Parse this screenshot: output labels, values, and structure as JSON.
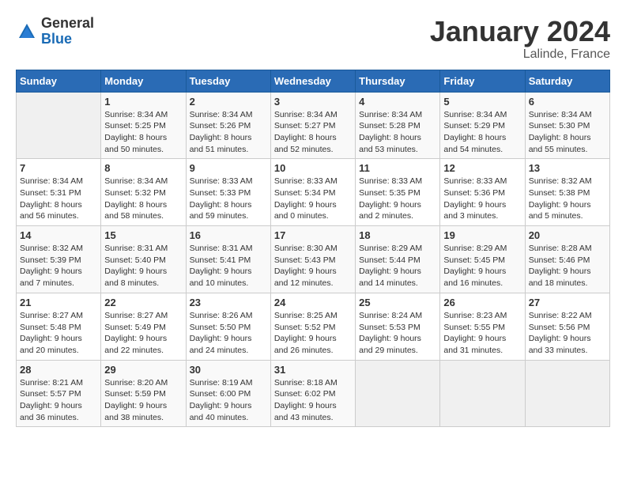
{
  "header": {
    "logo_general": "General",
    "logo_blue": "Blue",
    "month_year": "January 2024",
    "location": "Lalinde, France"
  },
  "weekdays": [
    "Sunday",
    "Monday",
    "Tuesday",
    "Wednesday",
    "Thursday",
    "Friday",
    "Saturday"
  ],
  "weeks": [
    [
      {
        "day": "",
        "sunrise": "",
        "sunset": "",
        "daylight": ""
      },
      {
        "day": "1",
        "sunrise": "Sunrise: 8:34 AM",
        "sunset": "Sunset: 5:25 PM",
        "daylight": "Daylight: 8 hours and 50 minutes."
      },
      {
        "day": "2",
        "sunrise": "Sunrise: 8:34 AM",
        "sunset": "Sunset: 5:26 PM",
        "daylight": "Daylight: 8 hours and 51 minutes."
      },
      {
        "day": "3",
        "sunrise": "Sunrise: 8:34 AM",
        "sunset": "Sunset: 5:27 PM",
        "daylight": "Daylight: 8 hours and 52 minutes."
      },
      {
        "day": "4",
        "sunrise": "Sunrise: 8:34 AM",
        "sunset": "Sunset: 5:28 PM",
        "daylight": "Daylight: 8 hours and 53 minutes."
      },
      {
        "day": "5",
        "sunrise": "Sunrise: 8:34 AM",
        "sunset": "Sunset: 5:29 PM",
        "daylight": "Daylight: 8 hours and 54 minutes."
      },
      {
        "day": "6",
        "sunrise": "Sunrise: 8:34 AM",
        "sunset": "Sunset: 5:30 PM",
        "daylight": "Daylight: 8 hours and 55 minutes."
      }
    ],
    [
      {
        "day": "7",
        "sunrise": "Sunrise: 8:34 AM",
        "sunset": "Sunset: 5:31 PM",
        "daylight": "Daylight: 8 hours and 56 minutes."
      },
      {
        "day": "8",
        "sunrise": "Sunrise: 8:34 AM",
        "sunset": "Sunset: 5:32 PM",
        "daylight": "Daylight: 8 hours and 58 minutes."
      },
      {
        "day": "9",
        "sunrise": "Sunrise: 8:33 AM",
        "sunset": "Sunset: 5:33 PM",
        "daylight": "Daylight: 8 hours and 59 minutes."
      },
      {
        "day": "10",
        "sunrise": "Sunrise: 8:33 AM",
        "sunset": "Sunset: 5:34 PM",
        "daylight": "Daylight: 9 hours and 0 minutes."
      },
      {
        "day": "11",
        "sunrise": "Sunrise: 8:33 AM",
        "sunset": "Sunset: 5:35 PM",
        "daylight": "Daylight: 9 hours and 2 minutes."
      },
      {
        "day": "12",
        "sunrise": "Sunrise: 8:33 AM",
        "sunset": "Sunset: 5:36 PM",
        "daylight": "Daylight: 9 hours and 3 minutes."
      },
      {
        "day": "13",
        "sunrise": "Sunrise: 8:32 AM",
        "sunset": "Sunset: 5:38 PM",
        "daylight": "Daylight: 9 hours and 5 minutes."
      }
    ],
    [
      {
        "day": "14",
        "sunrise": "Sunrise: 8:32 AM",
        "sunset": "Sunset: 5:39 PM",
        "daylight": "Daylight: 9 hours and 7 minutes."
      },
      {
        "day": "15",
        "sunrise": "Sunrise: 8:31 AM",
        "sunset": "Sunset: 5:40 PM",
        "daylight": "Daylight: 9 hours and 8 minutes."
      },
      {
        "day": "16",
        "sunrise": "Sunrise: 8:31 AM",
        "sunset": "Sunset: 5:41 PM",
        "daylight": "Daylight: 9 hours and 10 minutes."
      },
      {
        "day": "17",
        "sunrise": "Sunrise: 8:30 AM",
        "sunset": "Sunset: 5:43 PM",
        "daylight": "Daylight: 9 hours and 12 minutes."
      },
      {
        "day": "18",
        "sunrise": "Sunrise: 8:29 AM",
        "sunset": "Sunset: 5:44 PM",
        "daylight": "Daylight: 9 hours and 14 minutes."
      },
      {
        "day": "19",
        "sunrise": "Sunrise: 8:29 AM",
        "sunset": "Sunset: 5:45 PM",
        "daylight": "Daylight: 9 hours and 16 minutes."
      },
      {
        "day": "20",
        "sunrise": "Sunrise: 8:28 AM",
        "sunset": "Sunset: 5:46 PM",
        "daylight": "Daylight: 9 hours and 18 minutes."
      }
    ],
    [
      {
        "day": "21",
        "sunrise": "Sunrise: 8:27 AM",
        "sunset": "Sunset: 5:48 PM",
        "daylight": "Daylight: 9 hours and 20 minutes."
      },
      {
        "day": "22",
        "sunrise": "Sunrise: 8:27 AM",
        "sunset": "Sunset: 5:49 PM",
        "daylight": "Daylight: 9 hours and 22 minutes."
      },
      {
        "day": "23",
        "sunrise": "Sunrise: 8:26 AM",
        "sunset": "Sunset: 5:50 PM",
        "daylight": "Daylight: 9 hours and 24 minutes."
      },
      {
        "day": "24",
        "sunrise": "Sunrise: 8:25 AM",
        "sunset": "Sunset: 5:52 PM",
        "daylight": "Daylight: 9 hours and 26 minutes."
      },
      {
        "day": "25",
        "sunrise": "Sunrise: 8:24 AM",
        "sunset": "Sunset: 5:53 PM",
        "daylight": "Daylight: 9 hours and 29 minutes."
      },
      {
        "day": "26",
        "sunrise": "Sunrise: 8:23 AM",
        "sunset": "Sunset: 5:55 PM",
        "daylight": "Daylight: 9 hours and 31 minutes."
      },
      {
        "day": "27",
        "sunrise": "Sunrise: 8:22 AM",
        "sunset": "Sunset: 5:56 PM",
        "daylight": "Daylight: 9 hours and 33 minutes."
      }
    ],
    [
      {
        "day": "28",
        "sunrise": "Sunrise: 8:21 AM",
        "sunset": "Sunset: 5:57 PM",
        "daylight": "Daylight: 9 hours and 36 minutes."
      },
      {
        "day": "29",
        "sunrise": "Sunrise: 8:20 AM",
        "sunset": "Sunset: 5:59 PM",
        "daylight": "Daylight: 9 hours and 38 minutes."
      },
      {
        "day": "30",
        "sunrise": "Sunrise: 8:19 AM",
        "sunset": "Sunset: 6:00 PM",
        "daylight": "Daylight: 9 hours and 40 minutes."
      },
      {
        "day": "31",
        "sunrise": "Sunrise: 8:18 AM",
        "sunset": "Sunset: 6:02 PM",
        "daylight": "Daylight: 9 hours and 43 minutes."
      },
      {
        "day": "",
        "sunrise": "",
        "sunset": "",
        "daylight": ""
      },
      {
        "day": "",
        "sunrise": "",
        "sunset": "",
        "daylight": ""
      },
      {
        "day": "",
        "sunrise": "",
        "sunset": "",
        "daylight": ""
      }
    ]
  ]
}
